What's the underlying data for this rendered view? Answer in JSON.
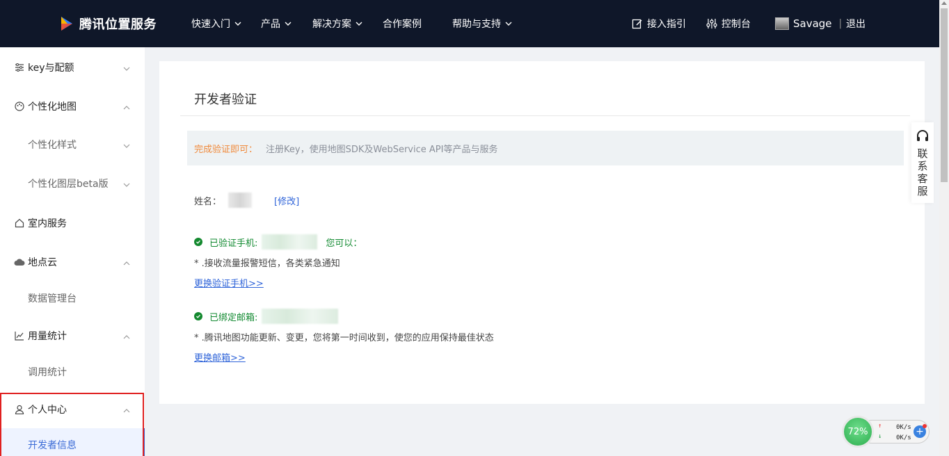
{
  "header": {
    "brand": "腾讯位置服务",
    "nav": [
      {
        "label": "快速入门",
        "dropdown": true
      },
      {
        "label": "产品",
        "dropdown": true
      },
      {
        "label": "解决方案",
        "dropdown": true
      },
      {
        "label": "合作案例",
        "dropdown": false
      },
      {
        "label": "帮助与支持",
        "dropdown": true
      }
    ],
    "guide": "接入指引",
    "console": "控制台",
    "username": "Savage",
    "separator": "|",
    "logout": "退出"
  },
  "sidebar": {
    "items": [
      {
        "label": "key与配额",
        "icon": "list-settings-icon",
        "expanded": false
      },
      {
        "label": "个性化地图",
        "icon": "palette-icon",
        "expanded": true
      },
      {
        "label": "个性化样式",
        "sub": true,
        "expanded": false
      },
      {
        "label": "个性化图层beta版",
        "sub": true,
        "expanded": false
      },
      {
        "label": "室内服务",
        "icon": "home-icon"
      },
      {
        "label": "地点云",
        "icon": "cloud-icon",
        "expanded": true
      },
      {
        "label": "数据管理台",
        "sub": true
      },
      {
        "label": "用量统计",
        "icon": "line-chart-icon",
        "expanded": true
      },
      {
        "label": "调用统计",
        "sub": true
      },
      {
        "label": "个人中心",
        "icon": "user-icon",
        "expanded": true
      },
      {
        "label": "开发者信息",
        "sub": true,
        "active": true
      }
    ]
  },
  "main": {
    "title": "开发者验证",
    "notice_highlight": "完成验证即可：",
    "notice_text": "注册Key，使用地图SDK及WebService API等产品与服务",
    "name_label": "姓名：",
    "name_edit": "[修改]",
    "phone_label": "已验证手机:",
    "phone_suffix": "您可以：",
    "phone_desc": "* .接收流量报警短信，各类紧急通知",
    "phone_change": "更换验证手机>>",
    "email_label": "已绑定邮箱:",
    "email_desc": "* .腾讯地图功能更新、变更，您将第一时间收到，使您的应用保持最佳状态",
    "email_change": "更换邮箱>>"
  },
  "service_tab": {
    "label": "联系客服"
  },
  "net_widget": {
    "percent": "72%",
    "up": "0K/s",
    "down": "0K/s",
    "plus": "+"
  },
  "colors": {
    "header_bg": "#0f1729",
    "accent": "#2f64d9",
    "success": "#128a31",
    "highlight": "#f08a3c",
    "alert_border": "#e02020"
  }
}
